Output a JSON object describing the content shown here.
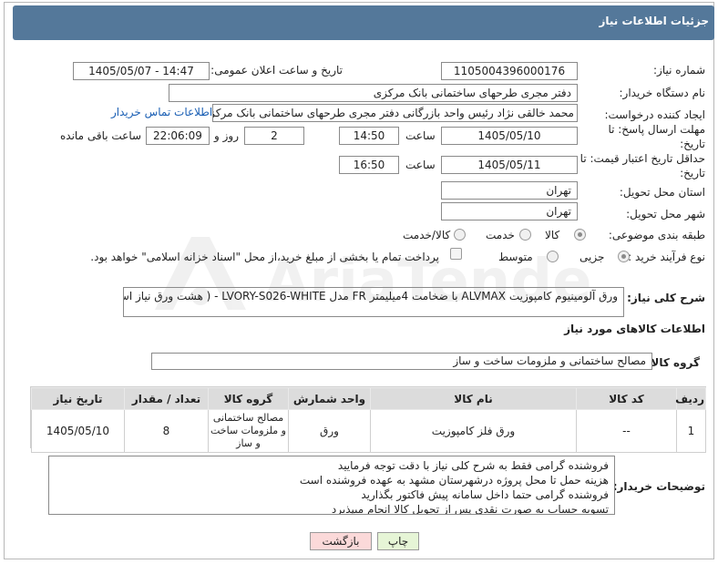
{
  "header": {
    "title": "جزئیات اطلاعات نیاز"
  },
  "fields": {
    "need_number": {
      "label": "شماره نیاز:",
      "value": "1105004396000176"
    },
    "announce_datetime": {
      "label": "تاریخ و ساعت اعلان عمومی:",
      "value": "1405/05/07 - 14:47"
    },
    "buyer_org": {
      "label": "نام دستگاه خریدار:",
      "value": "دفتر مجری طرحهای ساختمانی بانک مرکزی"
    },
    "requester": {
      "label": "ایجاد کننده درخواست:",
      "value": "محمد خالقی نژاد رئیس واحد بازرگانی دفتر مجری طرحهای ساختمانی بانک مرکز",
      "link": "اطلاعات تماس خریدار"
    },
    "deadline": {
      "label": "مهلت ارسال پاسخ: تا تاریخ:",
      "date": "1405/05/10",
      "time_label": "ساعت",
      "time": "14:50",
      "days": "2",
      "days_label": "روز و",
      "remaining": "22:06:09",
      "remaining_label": "ساعت باقی مانده"
    },
    "price_validity": {
      "label": "حداقل تاریخ اعتبار قیمت: تا تاریخ:",
      "date": "1405/05/11",
      "time_label": "ساعت",
      "time": "16:50"
    },
    "province": {
      "label": "استان محل تحویل:",
      "value": "تهران"
    },
    "city": {
      "label": "شهر محل تحویل:",
      "value": "تهران"
    },
    "category": {
      "label": "طبقه بندی موضوعی:",
      "options": [
        "کالا",
        "خدمت",
        "کالا/خدمت"
      ],
      "selected": "کالا"
    },
    "process_type": {
      "label": "نوع فرآیند خرید :",
      "options": [
        "جزیی",
        "متوسط"
      ],
      "selected": "جزیی",
      "payment_note": "پرداخت تمام یا بخشی از مبلغ خرید،از محل \"اسناد خزانه اسلامی\" خواهد بود."
    }
  },
  "description": {
    "label": "شرح کلی نیاز:",
    "value": "ورق آلومینیوم کامپوزیت ALVMAX با ضخامت 4میلیمتر FR مدل LVORY-S026-WHITE - ( هشت ورق نیاز است)"
  },
  "goods_section": {
    "title": "اطلاعات کالاهای مورد نیاز",
    "group_label": "گروه کالا:",
    "group_value": "مصالح ساختمانی و ملزومات ساخت و ساز",
    "columns": [
      "ردیف",
      "کد کالا",
      "نام کالا",
      "واحد شمارش",
      "گروه کالا",
      "تعداد / مقدار",
      "تاریخ نیاز"
    ],
    "rows": [
      [
        "1",
        "--",
        "ورق فلز کامپوزیت",
        "ورق",
        "مصالح ساختمانی و ملزومات ساخت و ساز",
        "8",
        "1405/05/10"
      ]
    ]
  },
  "buyer_notes": {
    "label": "توضیحات خریدار:",
    "lines": [
      "فروشنده گرامی فقط به شرح کلی نیاز با دقت توجه فرمایید",
      "هزینه حمل تا محل پروژه درشهرستان مشهد به عهده فروشنده است",
      "فروشنده گرامی حتما داخل سامانه پیش فاکتور بگذارید",
      "تسویه حساب به صورت نقدی پس از تحویل کالا  انجام میپذیرد"
    ]
  },
  "buttons": {
    "print": "چاپ",
    "back": "بازگشت"
  },
  "colors": {
    "header": "#54789a",
    "print_button": "#e6f5d6",
    "back_button": "#fbd9d9"
  },
  "watermark": "AriaTender.net"
}
